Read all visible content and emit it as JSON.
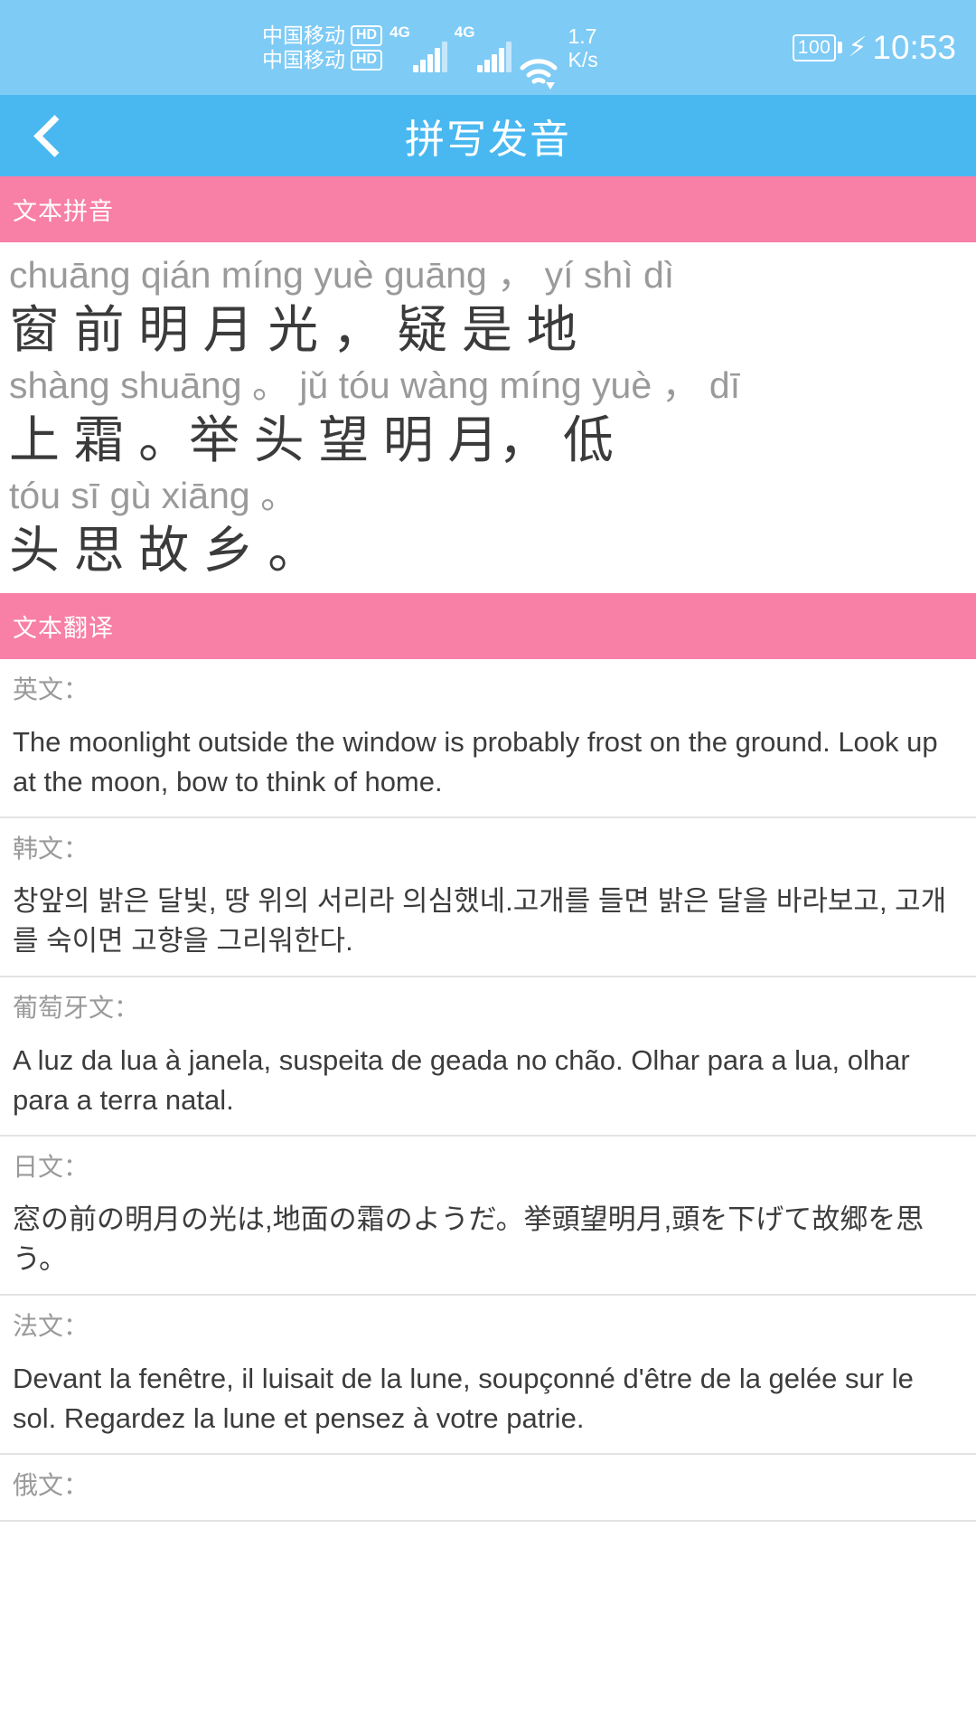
{
  "status_bar": {
    "carrier_lines": [
      "中国移动",
      "中国移动"
    ],
    "hd_badge": "HD",
    "network_type_1": "4G",
    "network_type_2": "4G",
    "net_speed_value": "1.7",
    "net_speed_unit": "K/s",
    "battery_percent": "100",
    "charging_glyph": "⚡",
    "clock": "10:53"
  },
  "title_bar": {
    "back_icon": "chevron-left-icon",
    "title": "拼写发音"
  },
  "pinyin_section": {
    "header": "文本拼音",
    "lines": [
      {
        "pinyin": "chuāng qián míng yuè guāng ，  yí shì dì",
        "hanzi": "窗 前 明 月 光 ， 疑 是 地"
      },
      {
        "pinyin": "shàng shuāng 。 jǔ tóu wàng míng yuè ，  dī",
        "hanzi": "上 霜 。举 头 望 明 月， 低"
      },
      {
        "pinyin": "tóu sī gù xiāng 。",
        "hanzi": "头 思 故 乡 。"
      }
    ]
  },
  "translation_section": {
    "header": "文本翻译",
    "items": [
      {
        "label": "英文：",
        "text": "The moonlight outside the window is probably frost on the ground. Look up at the moon, bow to think of home."
      },
      {
        "label": "韩文：",
        "text": "창앞의 밝은 달빛, 땅 위의 서리라 의심했네.고개를 들면 밝은 달을 바라보고, 고개를 숙이면 고향을 그리워한다."
      },
      {
        "label": "葡萄牙文：",
        "text": "A luz da lua à janela, suspeita de geada no chão. Olhar para a lua, olhar para a terra natal."
      },
      {
        "label": "日文：",
        "text": "窓の前の明月の光は,地面の霜のようだ。挙頭望明月,頭を下げて故郷を思う。"
      },
      {
        "label": "法文：",
        "text": "Devant la fenêtre, il luisait de la lune, soupçonné d'être de la gelée sur le sol. Regardez la lune et pensez à votre patrie."
      },
      {
        "label": "俄文：",
        "text": ""
      }
    ]
  },
  "colors": {
    "status_bar_bg": "#7ecbf5",
    "title_bar_bg": "#4ab8f0",
    "section_header_bg": "#f87fa6",
    "pinyin_text": "#9a9a9a",
    "hanzi_text": "#3b3b3b",
    "body_text": "#3c3c3c"
  }
}
